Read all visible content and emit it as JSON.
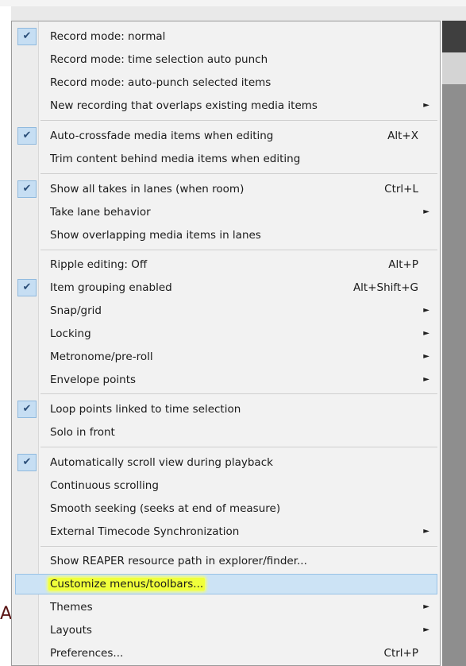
{
  "menu": {
    "items": [
      {
        "label": "Record mode: normal",
        "checked": true,
        "shortcut": "",
        "submenu": false
      },
      {
        "label": "Record mode: time selection auto punch",
        "checked": false,
        "shortcut": "",
        "submenu": false
      },
      {
        "label": "Record mode: auto-punch selected items",
        "checked": false,
        "shortcut": "",
        "submenu": false
      },
      {
        "label": "New recording that overlaps existing media items",
        "checked": false,
        "shortcut": "",
        "submenu": true
      },
      {
        "label": "Auto-crossfade media items when editing",
        "checked": true,
        "shortcut": "Alt+X",
        "submenu": false
      },
      {
        "label": "Trim content behind media items when editing",
        "checked": false,
        "shortcut": "",
        "submenu": false
      },
      {
        "label": "Show all takes in lanes (when room)",
        "checked": true,
        "shortcut": "Ctrl+L",
        "submenu": false
      },
      {
        "label": "Take lane behavior",
        "checked": false,
        "shortcut": "",
        "submenu": true
      },
      {
        "label": "Show overlapping media items in lanes",
        "checked": false,
        "shortcut": "",
        "submenu": false
      },
      {
        "label": "Ripple editing: Off",
        "checked": false,
        "shortcut": "Alt+P",
        "submenu": false
      },
      {
        "label": "Item grouping enabled",
        "checked": true,
        "shortcut": "Alt+Shift+G",
        "submenu": false
      },
      {
        "label": "Snap/grid",
        "checked": false,
        "shortcut": "",
        "submenu": true
      },
      {
        "label": "Locking",
        "checked": false,
        "shortcut": "",
        "submenu": true
      },
      {
        "label": "Metronome/pre-roll",
        "checked": false,
        "shortcut": "",
        "submenu": true
      },
      {
        "label": "Envelope points",
        "checked": false,
        "shortcut": "",
        "submenu": true
      },
      {
        "label": "Loop points linked to time selection",
        "checked": true,
        "shortcut": "",
        "submenu": false
      },
      {
        "label": "Solo in front",
        "checked": false,
        "shortcut": "",
        "submenu": false
      },
      {
        "label": "Automatically scroll view during playback",
        "checked": true,
        "shortcut": "",
        "submenu": false
      },
      {
        "label": "Continuous scrolling",
        "checked": false,
        "shortcut": "",
        "submenu": false
      },
      {
        "label": "Smooth seeking (seeks at end of measure)",
        "checked": false,
        "shortcut": "",
        "submenu": false
      },
      {
        "label": "External Timecode Synchronization",
        "checked": false,
        "shortcut": "",
        "submenu": true
      },
      {
        "label": "Show REAPER resource path in explorer/finder...",
        "checked": false,
        "shortcut": "",
        "submenu": false
      },
      {
        "label": "Customize menus/toolbars...",
        "checked": false,
        "shortcut": "",
        "submenu": false,
        "highlighted": true
      },
      {
        "label": "Themes",
        "checked": false,
        "shortcut": "",
        "submenu": true
      },
      {
        "label": "Layouts",
        "checked": false,
        "shortcut": "",
        "submenu": true
      },
      {
        "label": "Preferences...",
        "checked": false,
        "shortcut": "Ctrl+P",
        "submenu": false
      }
    ]
  },
  "colors": {
    "hover_background": "#cce3f5",
    "text_highlighter": "#f0ff3a",
    "check_background": "#c6def3"
  },
  "icons": {
    "check": "check-icon",
    "submenu": "chevron-right-icon"
  },
  "background": {
    "left_edge_glyph": "A"
  }
}
